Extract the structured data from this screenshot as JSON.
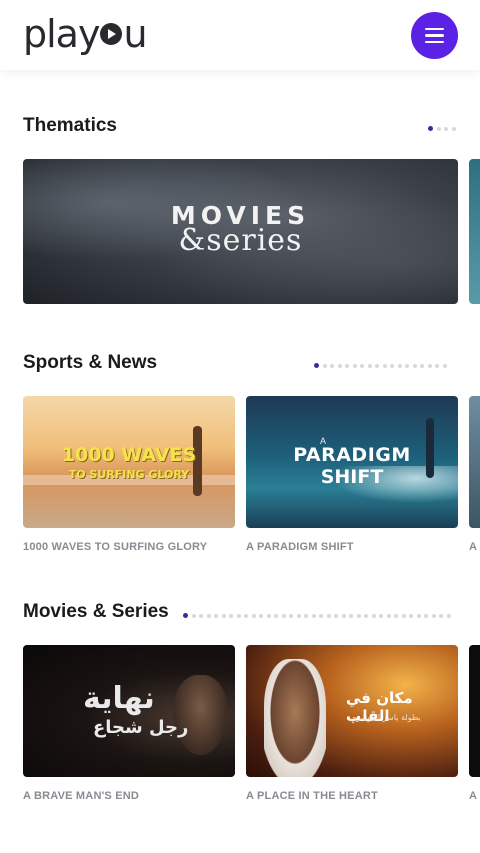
{
  "header": {
    "logo_left": "play",
    "logo_right": "u",
    "menu_icon": "hamburger-menu-icon"
  },
  "colors": {
    "accent": "#5b22e6",
    "dot_active": "#3d2a9a",
    "dot_inactive": "#d8d8e0",
    "caption": "#8a8a92"
  },
  "sections": {
    "thematics": {
      "title": "Thematics",
      "dots": 4,
      "active_dot": 0,
      "banner": {
        "line1": "MOVIES",
        "line2": "&series"
      }
    },
    "sports": {
      "title": "Sports & News",
      "dots": 18,
      "active_dot": 0,
      "cards": [
        {
          "caption": "1000 WAVES TO SURFING GLORY",
          "art_title": "1000 WAVES",
          "art_sub": "TO SURFING GLORY"
        },
        {
          "caption": "A PARADIGM SHIFT",
          "art_pre": "A",
          "art_title": "PARADIGM",
          "art_sub": "SHIFT"
        },
        {
          "caption": "A"
        }
      ]
    },
    "movies": {
      "title": "Movies & Series",
      "dots": 36,
      "active_dot": 0,
      "cards": [
        {
          "caption": "A BRAVE MAN'S END",
          "art_title": "نهاية",
          "art_sub": "رجل شجاع"
        },
        {
          "caption": "A PLACE IN THE HEART",
          "art_title": "مكان في القلب",
          "art_sub": "بطولة ياسر الدوسري"
        },
        {
          "caption": "A"
        }
      ]
    }
  }
}
